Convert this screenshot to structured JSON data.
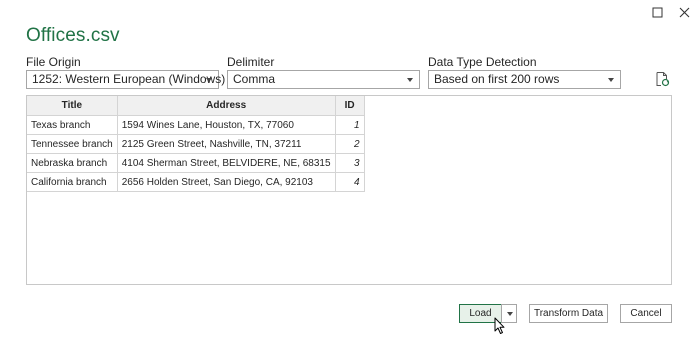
{
  "window": {
    "maximize_icon": "maximize-icon",
    "close_icon": "close-icon"
  },
  "title": "Offices.csv",
  "file_origin": {
    "label": "File Origin",
    "value": "1252: Western European (Windows)"
  },
  "delimiter": {
    "label": "Delimiter",
    "value": "Comma"
  },
  "data_type_detection": {
    "label": "Data Type Detection",
    "value": "Based on first 200 rows"
  },
  "refresh_icon": "refresh-document-icon",
  "table": {
    "headers": [
      "Title",
      "Address",
      "ID"
    ],
    "rows": [
      [
        "Texas branch",
        "1594 Wines Lane, Houston, TX, 77060",
        "1"
      ],
      [
        "Tennessee branch",
        "2125 Green Street, Nashville, TN, 37211",
        "2"
      ],
      [
        "Nebraska branch",
        "4104 Sherman Street, BELVIDERE, NE, 68315",
        "3"
      ],
      [
        "California branch",
        "2656 Holden Street, San Diego, CA, 92103",
        "4"
      ]
    ]
  },
  "buttons": {
    "load": "Load",
    "transform": "Transform Data",
    "cancel": "Cancel"
  },
  "colors": {
    "title_green": "#217346",
    "load_highlight": "#e7f1e9"
  }
}
